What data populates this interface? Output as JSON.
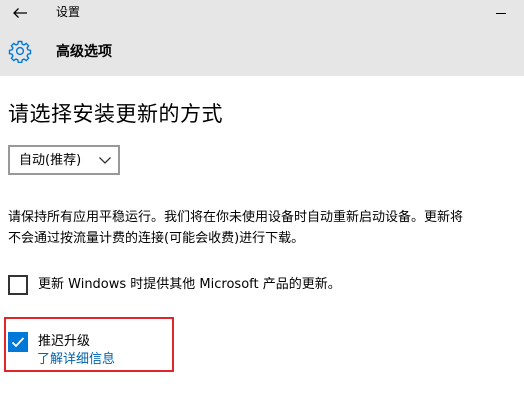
{
  "window": {
    "title": "设置"
  },
  "header": {
    "section_title": "高级选项"
  },
  "main": {
    "page_title": "请选择安装更新的方式",
    "install_mode": {
      "selected": "自动(推荐)"
    },
    "description": "请保持所有应用平稳运行。我们将在你未使用设备时自动重新启动设备。更新将不会通过按流量计费的连接(可能会收费)进行下载。",
    "options": [
      {
        "label": "更新 Windows 时提供其他 Microsoft 产品的更新。",
        "checked": false
      },
      {
        "label": "推迟升级",
        "checked": true
      }
    ],
    "learn_more": "了解详细信息"
  },
  "colors": {
    "header_bg": "#e6e6e6",
    "accent": "#0078d7",
    "link": "#0063b1",
    "highlight": "#e0262b"
  },
  "icons": [
    "back-arrow-icon",
    "gear-icon",
    "chevron-down-icon",
    "checkmark-icon",
    "minimize-icon"
  ]
}
